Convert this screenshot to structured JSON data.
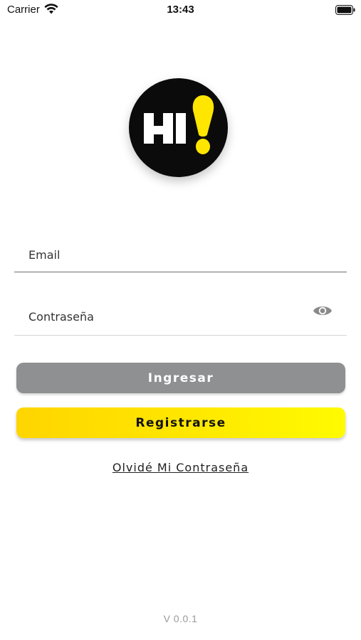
{
  "status_bar": {
    "carrier": "Carrier",
    "time": "13:43",
    "wifi_icon": "wifi-icon",
    "battery_icon": "battery-icon"
  },
  "logo": {
    "text": "HI!",
    "icon": "hi-logo",
    "background_color": "#0b0b0b",
    "accent_color": "#ffe600"
  },
  "form": {
    "email_placeholder": "Email",
    "email_value": "",
    "password_placeholder": "Contraseña",
    "password_value": "",
    "show_password_icon": "eye-icon"
  },
  "buttons": {
    "login_label": "Ingresar",
    "login_color": "#8f9091",
    "register_label": "Registrarse",
    "register_color": "#ffe100"
  },
  "links": {
    "forgot_password": "Olvidé Mi Contraseña"
  },
  "footer": {
    "version": "V 0.0.1"
  }
}
